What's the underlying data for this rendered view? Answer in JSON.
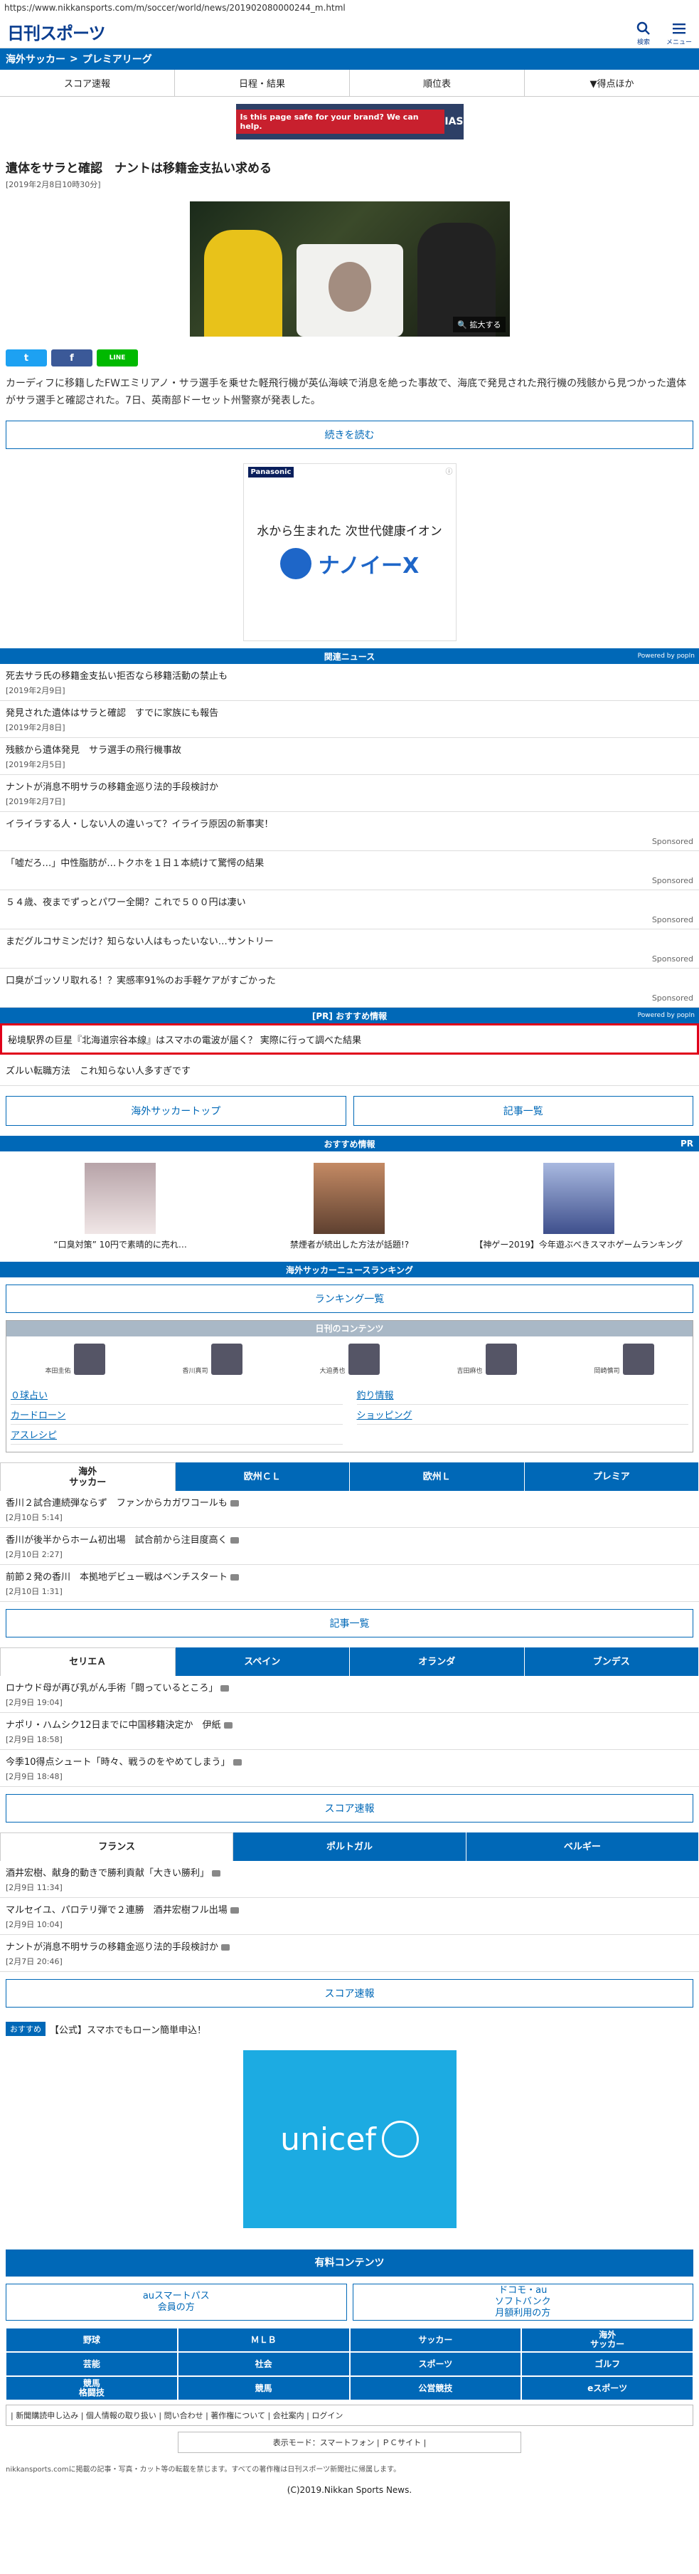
{
  "url": "https://www.nikkansports.com/m/soccer/world/news/201902080000244_m.html",
  "header": {
    "logo": "日刊スポーツ",
    "search_label": "検索",
    "menu_label": "メニュー"
  },
  "breadcrumb": {
    "section": "海外サッカー",
    "sep": ">",
    "sub": "プレミアリーグ"
  },
  "topnav": [
    "スコア速報",
    "日程・結果",
    "順位表",
    "▼得点ほか"
  ],
  "ad_top": {
    "text": "Is this page safe for your brand? We can help.",
    "brand": "IAS"
  },
  "article": {
    "title": "遺体をサラと確認　ナントは移籍金支払い求める",
    "date": "[2019年2月8日10時30分]",
    "zoom": "拡大する",
    "lead": "カーディフに移籍したFWエミリアノ・サラ選手を乗せた軽飛行機が英仏海峡で消息を絶った事故で、海底で発見された飛行機の残骸から見つかった遺体がサラ選手と確認された。7日、英南部ドーセット州警察が発表した。",
    "more": "続きを読む"
  },
  "share": {
    "tw": "t",
    "fb": "f",
    "line": "LINE"
  },
  "ad_rect": {
    "brand": "Panasonic",
    "copy": "水から生まれた 次世代健康イオン",
    "product": "ナノイーX"
  },
  "related": {
    "head": "関連ニュース",
    "powered": "Powered by popIn",
    "items": [
      {
        "t": "死去サラ氏の移籍金支払い拒否なら移籍活動の禁止も",
        "d": "[2019年2月9日]"
      },
      {
        "t": "発見された遺体はサラと確認　すでに家族にも報告",
        "d": "[2019年2月8日]"
      },
      {
        "t": "残骸から遺体発見　サラ選手の飛行機事故",
        "d": "[2019年2月5日]"
      },
      {
        "t": "ナントが消息不明サラの移籍金巡り法的手段検討か",
        "d": "[2019年2月7日]"
      }
    ],
    "sponsored": [
      "イライラする人・しない人の違いって？イライラ原因の新事実！",
      "「嘘だろ…」中性脂肪が…トクホを１日１本続けて驚愕の結果",
      "５４歳、夜までずっとパワー全開？これで５００円は凄い",
      "まだグルコサミンだけ？知らない人はもったいない…サントリー",
      "口臭がゴッソリ取れる！？実感率91%のお手軽ケアがすごかった"
    ],
    "sponsored_label": "Sponsored"
  },
  "pr": {
    "head": "[PR] おすすめ情報",
    "powered": "Powered by popIn",
    "items": [
      "秘境駅界の巨星『北海道宗谷本線』はスマホの電波が届く？ 実際に行って調べた結果",
      "ズルい転職方法　これ知らない人多すぎです"
    ]
  },
  "nav_buttons": [
    "海外サッカートップ",
    "記事一覧"
  ],
  "recommend": {
    "head": "おすすめ情報",
    "pr": "PR",
    "cards": [
      "“口臭対策” 10円で素晴的に売れ…",
      "禁煙者が続出した方法が話題!?",
      "【神ゲー2019】今年遊ぶべきスマホゲームランキング"
    ]
  },
  "ranking": {
    "head": "海外サッカーニュースランキング",
    "button": "ランキング一覧"
  },
  "daily": {
    "head": "日刊のコンテンツ",
    "players": [
      "本田圭佑",
      "香川真司",
      "大迫勇也",
      "吉田麻也",
      "岡崎慎司"
    ],
    "links": [
      "０球占い",
      "釣り情報",
      "カードローン",
      "ショッピング",
      "アスレシピ"
    ]
  },
  "league1": {
    "tabs": [
      "海外\nサッカー",
      "欧州ＣＬ",
      "欧州Ｌ",
      "プレミア"
    ],
    "items": [
      {
        "t": "香川２試合連続弾ならず　ファンからカガワコールも",
        "d": "[2月10日 5:14]"
      },
      {
        "t": "香川が後半からホーム初出場　試合前から注目度高く",
        "d": "[2月10日 2:27]"
      },
      {
        "t": "前節２発の香川　本拠地デビュー戦はベンチスタート",
        "d": "[2月10日 1:31]"
      }
    ],
    "button": "記事一覧"
  },
  "league2": {
    "tabs": [
      "セリエＡ",
      "スペイン",
      "オランダ",
      "ブンデス"
    ],
    "items": [
      {
        "t": "ロナウド母が再び乳がん手術「闘っているところ」",
        "d": "[2月9日 19:04]"
      },
      {
        "t": "ナポリ・ハムシク12日までに中国移籍決定か　伊紙",
        "d": "[2月9日 18:58]"
      },
      {
        "t": "今季10得点シュート「時々、戦うのをやめてしまう」",
        "d": "[2月9日 18:48]"
      }
    ],
    "button": "スコア速報"
  },
  "league3": {
    "tabs": [
      "フランス",
      "ポルトガル",
      "ベルギー"
    ],
    "items": [
      {
        "t": "酒井宏樹、献身的動きで勝利貢献「大きい勝利」",
        "d": "[2月9日 11:34]"
      },
      {
        "t": "マルセイユ、パロテリ弾で２連勝　酒井宏樹フル出場",
        "d": "[2月9日 10:04]"
      },
      {
        "t": "ナントが消息不明サラの移籍金巡り法的手段検討か",
        "d": "[2月7日 20:46]"
      }
    ],
    "button": "スコア速報"
  },
  "recline": {
    "tag": "おすすめ",
    "text": "【公式】スマホでもローン簡単申込！"
  },
  "unicef": "unicef",
  "paid": {
    "head": "有料コンテンツ",
    "btns": [
      "auスマートパス\n会員の方",
      "ドコモ・au\nソフトバンク\n月額利用の方"
    ]
  },
  "grid": [
    "野球",
    "ＭＬＢ",
    "サッカー",
    "海外\nサッカー",
    "芸能",
    "社会",
    "スポーツ",
    "ゴルフ",
    "競馬\n格闘技",
    "競馬",
    "公営競技",
    "eスポーツ"
  ],
  "footlinks": "| 新聞購読申し込み | 個人情報の取り扱い | 問い合わせ | 著作権について | 会社案内 | ログイン",
  "dispmode": "表示モード：スマートフォン | ＰＣサイト |",
  "notice": "nikkansports.comに掲載の記事・写真・カット等の転載を禁じます。すべての著作権は日刊スポーツ新聞社に帰属します。",
  "copyright": "(C)2019.Nikkan Sports News."
}
